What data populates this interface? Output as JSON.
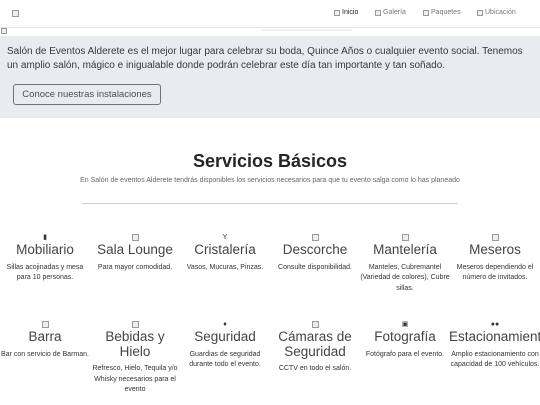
{
  "nav": {
    "items": [
      {
        "label": "Inicio",
        "active": true
      },
      {
        "label": "Galería",
        "active": false
      },
      {
        "label": "Paquetes",
        "active": false
      },
      {
        "label": "Ubicación",
        "active": false
      }
    ]
  },
  "intro": {
    "text": "Salón de Eventos Alderete es el mejor lugar para celebrar su boda, Quince Años o cualquier evento social. Tenemos un amplio salón, mágico e inigualable donde podrán celebrar este día tan importante y tan soñado.",
    "button_label": "Conoce nuestras instalaciones"
  },
  "services": {
    "title": "Servicios Básicos",
    "subtitle": "En Salón de eventos Alderete tendrás disponibles los servicios necesarios para que tu evento salga como lo has planeado",
    "items": [
      {
        "title": "Mobiliario",
        "desc": "Sillas acojinadas y mesa para 10 personas.",
        "icon": "chair-icon"
      },
      {
        "title": "Sala Lounge",
        "desc": "Para mayor comodidad.",
        "icon": "sofa-icon"
      },
      {
        "title": "Cristalería",
        "desc": "Vasos, Mucuras, Pinzas.",
        "icon": "glass-icon"
      },
      {
        "title": "Descorche",
        "desc": "Consulte disponibilidad.",
        "icon": "bottle-icon"
      },
      {
        "title": "Mantelería",
        "desc": "Manteles, Cubremantel (Variedad de colores), Cubre sillas.",
        "icon": "tablecloth-icon"
      },
      {
        "title": "Meseros",
        "desc": "Meseros dependiendo el número de invitados.",
        "icon": "waiter-icon"
      },
      {
        "title": "Barra",
        "desc": "Bar con servicio de Barman.",
        "icon": "bar-icon"
      },
      {
        "title": "Bebidas y Hielo",
        "desc": "Refresco, Hielo, Tequila y/o Whisky necesarios para el evento",
        "icon": "drink-icon"
      },
      {
        "title": "Seguridad",
        "desc": "Guardias de seguridad durante todo el evento.",
        "icon": "shield-icon"
      },
      {
        "title": "Cámaras de Seguridad",
        "desc": "CCTV en todo el salón.",
        "icon": "camera-cctv-icon"
      },
      {
        "title": "Fotografía",
        "desc": "Fotógrafo para el evento.",
        "icon": "camera-icon"
      },
      {
        "title": "Estacionamiento",
        "desc": "Amplio estacionamiento con capacidad de 100 vehículos.",
        "icon": "car-icon"
      }
    ]
  }
}
